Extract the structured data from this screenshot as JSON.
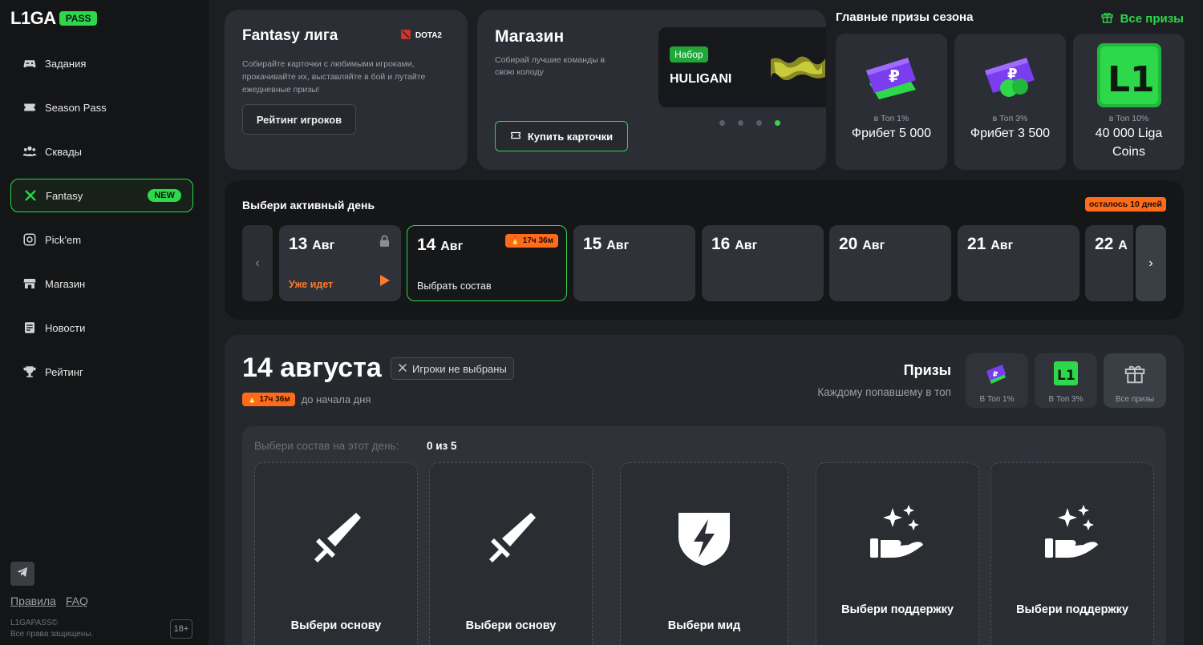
{
  "app": {
    "logo_text": "L1GA",
    "logo_badge": "PASS"
  },
  "sidebar": {
    "items": [
      {
        "label": "Задания",
        "icon": "gamepad-icon"
      },
      {
        "label": "Season Pass",
        "icon": "ticket-icon"
      },
      {
        "label": "Сквады",
        "icon": "squad-icon"
      },
      {
        "label": "Fantasy",
        "icon": "crossed-swords-icon",
        "badge": "NEW",
        "active": true
      },
      {
        "label": "Pick'em",
        "icon": "target-icon"
      },
      {
        "label": "Магазин",
        "icon": "store-icon"
      },
      {
        "label": "Новости",
        "icon": "news-icon"
      },
      {
        "label": "Рейтинг",
        "icon": "trophy-icon"
      }
    ],
    "rules_link": "Правила",
    "faq_link": "FAQ",
    "copyright_1": "L1GAPASS©",
    "copyright_2": "Все права защищены.",
    "age_badge": "18+"
  },
  "fantasy_card": {
    "title": "Fantasy лига",
    "game_tag": "DOTA2",
    "description": "Собирайте карточки с любимыми игроками, прокачивайте их, выставляйте в бой и лутайте ежедневные призы!",
    "button": "Рейтинг игроков"
  },
  "shop_card": {
    "title": "Магазин",
    "description": "Собирай лучшие команды в свою колоду",
    "button": "Купить карточки",
    "banner_tag": "Набор",
    "banner_title": "HULIGANI",
    "slides_total": 4,
    "slide_active": 4
  },
  "season_prizes": {
    "title": "Главные призы сезона",
    "all_link": "Все призы",
    "items": [
      {
        "rank": "в Топ 1%",
        "name": "Фрибет 5 000"
      },
      {
        "rank": "в Топ 3%",
        "name": "Фрибет 3 500"
      },
      {
        "rank": "в Топ 10%",
        "name": "40 000 Liga Coins"
      }
    ]
  },
  "day_selector": {
    "title": "Выбери активный день",
    "days_left": "осталось 10 дней",
    "days": [
      {
        "num": "13",
        "month": "Авг",
        "status": "Уже идет"
      },
      {
        "num": "14",
        "month": "Авг",
        "timer": "17ч 36м",
        "action": "Выбрать состав"
      },
      {
        "num": "15",
        "month": "Авг"
      },
      {
        "num": "16",
        "month": "Авг"
      },
      {
        "num": "20",
        "month": "Авг"
      },
      {
        "num": "21",
        "month": "Авг"
      },
      {
        "num": "22",
        "month": "А"
      }
    ]
  },
  "day_detail": {
    "date": "14 августа",
    "no_players": "Игроки не выбраны",
    "timer": "17ч 36м",
    "timer_suffix": "до начала дня",
    "prizes_title": "Призы",
    "prizes_sub": "Каждому попавшему в топ",
    "mini_prizes": [
      {
        "label": "В Топ 1%"
      },
      {
        "label": "В Топ 3%"
      },
      {
        "label": "Все призы"
      }
    ],
    "lineup_label": "Выбери состав на этот день:",
    "lineup_count": "0 из 5",
    "slots": [
      {
        "label": "Выбери основу",
        "icon": "sword-icon"
      },
      {
        "label": "Выбери основу",
        "icon": "sword-icon"
      },
      {
        "label": "Выбери мид",
        "icon": "shield-bolt-icon"
      },
      {
        "label": "Выбери поддержку",
        "icon": "hand-sparkles-icon"
      },
      {
        "label": "Выбери поддержку",
        "icon": "hand-sparkles-icon"
      }
    ]
  },
  "colors": {
    "accent": "#2dd84a",
    "warning": "#ff6b1a",
    "panel": "#2b2e34",
    "background": "#1c1e22"
  }
}
